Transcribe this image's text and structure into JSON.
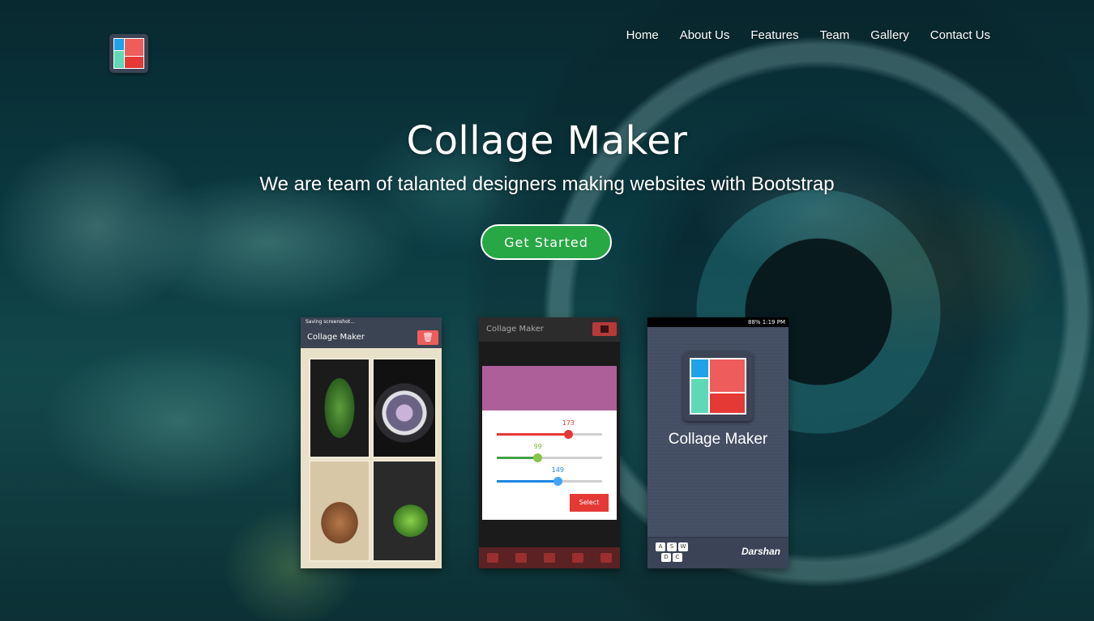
{
  "nav": {
    "items": [
      "Home",
      "About Us",
      "Features",
      "Team",
      "Gallery",
      "Contact Us"
    ]
  },
  "hero": {
    "title": "Collage Maker",
    "subtitle": "We are team of talanted designers making websites with Bootstrap",
    "cta_label": "Get Started"
  },
  "phones": {
    "p1": {
      "status": "Saving screenshot...",
      "title": "Collage Maker"
    },
    "p2": {
      "title": "Collage Maker",
      "red_value": "173",
      "green_value": "99",
      "blue_value": "149",
      "select_label": "Select",
      "red": 0.68,
      "green": 0.39,
      "blue": 0.58
    },
    "p3": {
      "status": "88%  1:19 PM",
      "app_name": "Collage Maker",
      "brand": "Darshan",
      "keys": [
        "A",
        "S",
        "W",
        "D",
        "C"
      ]
    }
  },
  "colors": {
    "accent_green": "#28a745",
    "logo_blue": "#1fa2e8",
    "logo_teal": "#5fd8b5",
    "logo_red": "#ef5c5c"
  }
}
